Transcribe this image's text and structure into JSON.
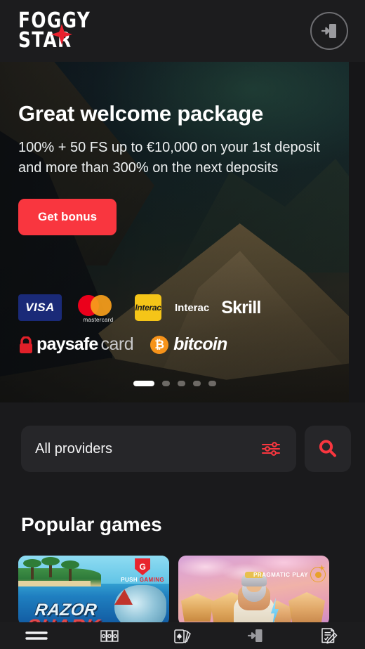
{
  "header": {
    "logo_line_1": "FOGGY",
    "logo_line_2": "STAR",
    "login_icon": "login-door-icon",
    "accent_color": "#f9363f"
  },
  "banner": {
    "title": "Great welcome package",
    "subtitle_line_1": "100% + 50 FS up to €10,000 on your 1st deposit",
    "subtitle_line_2": "and more than 300% on the next deposits",
    "cta_label": "Get bonus",
    "payments_row_1": [
      {
        "name": "VISA",
        "icon": "visa-logo"
      },
      {
        "name": "mastercard",
        "icon": "mastercard-logo"
      },
      {
        "name": "Interac",
        "icon": "interac-logo"
      },
      {
        "name": "Skrill",
        "icon": "skrill-logo"
      }
    ],
    "payments_row_2": [
      {
        "name": "paysafe",
        "name_2": "card",
        "icon": "paysafecard-logo"
      },
      {
        "name": "bitcoin",
        "symbol": "₿",
        "icon": "bitcoin-logo"
      }
    ],
    "carousel": {
      "total": 5,
      "active_index": 0
    }
  },
  "filters": {
    "providers_label": "All providers",
    "filter_icon": "sliders-icon",
    "search_icon": "search-icon"
  },
  "popular": {
    "title": "Popular games",
    "games": [
      {
        "title_line_1": "RAZOR",
        "title_line_2": "SHARK",
        "provider": "PUSH GAMING",
        "provider_word_1": "PUSH",
        "provider_word_2": "GAMING",
        "badge_letter": "G"
      },
      {
        "title_line_1": "",
        "title_line_2": "",
        "provider": "PRAGMATIC PLAY",
        "provider_word_1": "PRAGMATIC",
        "provider_word_2": "PLAY",
        "badge_letter": ""
      }
    ]
  },
  "bottom_nav": [
    {
      "name": "menu",
      "icon": "hamburger-menu-icon"
    },
    {
      "name": "slots",
      "icon": "slot-machine-icon"
    },
    {
      "name": "live-casino",
      "icon": "playing-cards-icon"
    },
    {
      "name": "login",
      "icon": "login-door-icon"
    },
    {
      "name": "register",
      "icon": "signup-form-pen-icon"
    }
  ]
}
